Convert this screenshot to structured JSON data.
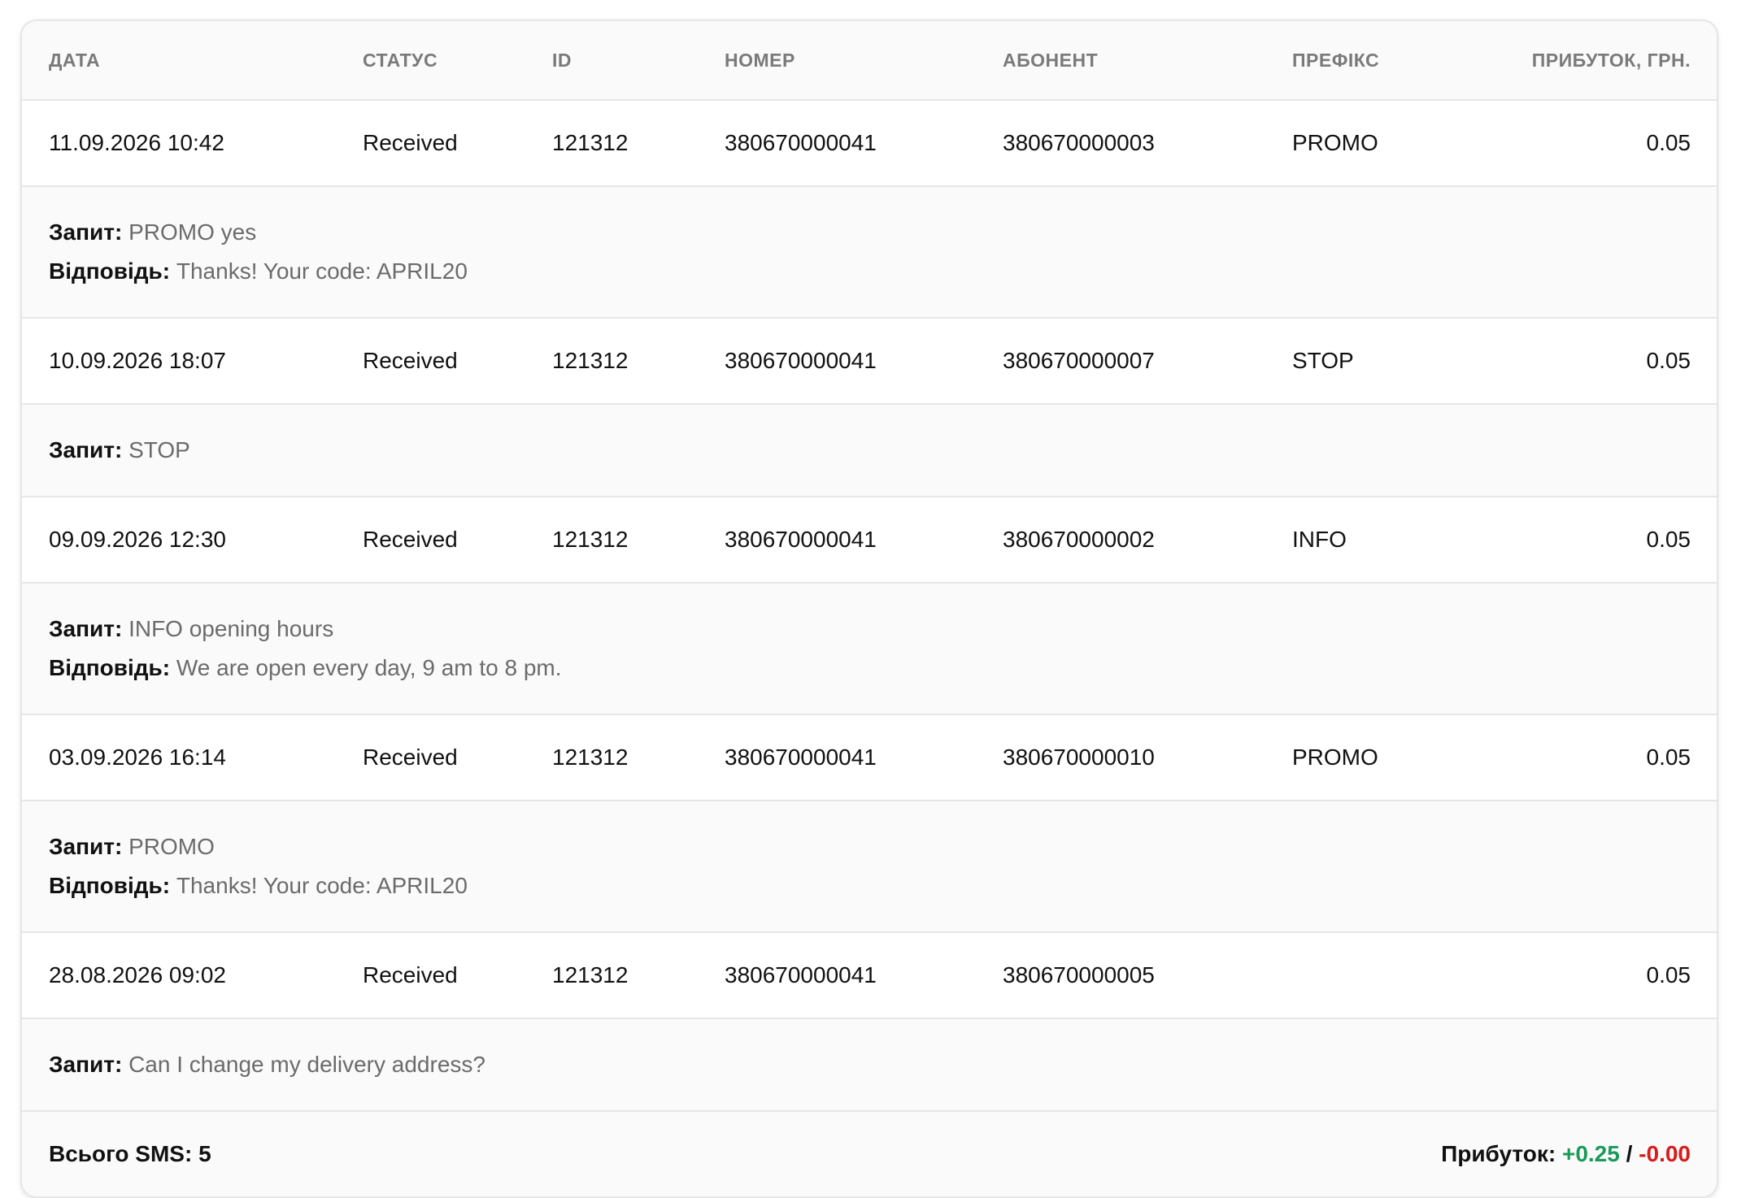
{
  "columns": {
    "date": "ДАТА",
    "status": "СТАТУС",
    "id": "ID",
    "number": "НОМЕР",
    "subscriber": "АБОНЕНТ",
    "prefix": "ПРЕФІКС",
    "profit": "ПРИБУТОК, ГРН."
  },
  "labels": {
    "request": "Запит:",
    "response": "Відповідь:"
  },
  "rows": [
    {
      "date": "11.09.2026 10:42",
      "status": "Received",
      "id": "121312",
      "number": "380670000041",
      "subscriber": "380670000003",
      "prefix": "PROMO",
      "profit": "0.05",
      "request": "PROMO yes",
      "response": "Thanks! Your code: APRIL20"
    },
    {
      "date": "10.09.2026 18:07",
      "status": "Received",
      "id": "121312",
      "number": "380670000041",
      "subscriber": "380670000007",
      "prefix": "STOP",
      "profit": "0.05",
      "request": "STOP",
      "response": null
    },
    {
      "date": "09.09.2026 12:30",
      "status": "Received",
      "id": "121312",
      "number": "380670000041",
      "subscriber": "380670000002",
      "prefix": "INFO",
      "profit": "0.05",
      "request": "INFO opening hours",
      "response": "We are open every day, 9 am to 8 pm."
    },
    {
      "date": "03.09.2026 16:14",
      "status": "Received",
      "id": "121312",
      "number": "380670000041",
      "subscriber": "380670000010",
      "prefix": "PROMO",
      "profit": "0.05",
      "request": "PROMO",
      "response": "Thanks! Your code: APRIL20"
    },
    {
      "date": "28.08.2026 09:02",
      "status": "Received",
      "id": "121312",
      "number": "380670000041",
      "subscriber": "380670000005",
      "prefix": "",
      "profit": "0.05",
      "request": "Can I change my delivery address?",
      "response": null
    }
  ],
  "footer": {
    "total_label": "Всього SMS: 5",
    "profit_label": "Прибуток:",
    "profit_positive": "+0.25",
    "separator": "/",
    "profit_negative": "-0.00"
  },
  "colors": {
    "positive": "#1a9a5a",
    "negative": "#d81b1b",
    "muted_text": "#6b6b6b",
    "header_text": "#7a7a7a",
    "border": "#e6e6e6"
  }
}
